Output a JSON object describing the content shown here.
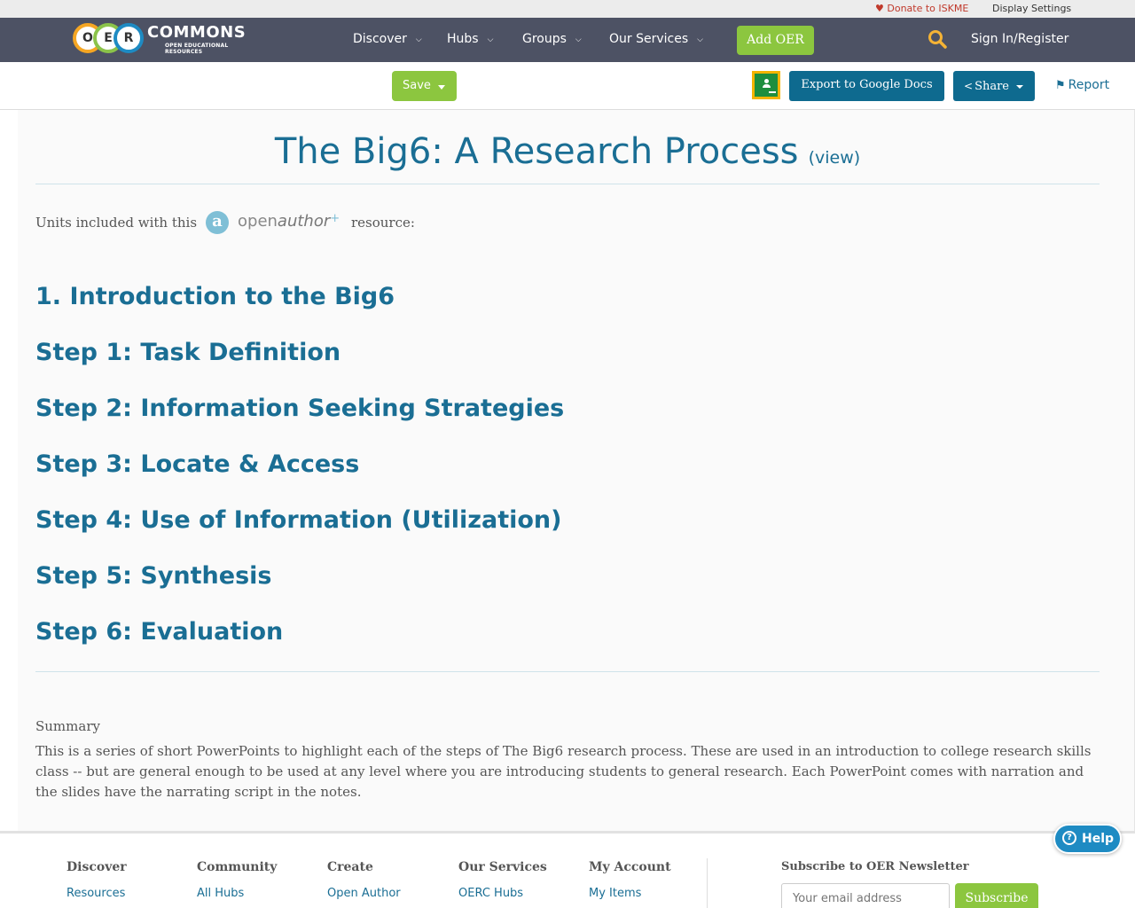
{
  "utility_bar": {
    "donate_label": "Donate to ISKME",
    "display_settings_label": "Display Settings"
  },
  "header": {
    "logo": {
      "letters": [
        "O",
        "E",
        "R"
      ],
      "word": "COMMONS",
      "tagline": "OPEN EDUCATIONAL RESOURCES"
    },
    "nav": [
      {
        "label": "Discover"
      },
      {
        "label": "Hubs"
      },
      {
        "label": "Groups"
      },
      {
        "label": "Our Services"
      }
    ],
    "add_oer_label": "Add OER",
    "sign_in_label": "Sign In/Register"
  },
  "toolbar": {
    "save_label": "Save",
    "export_label": "Export to Google Docs",
    "share_label": "Share",
    "report_label": "Report"
  },
  "resource": {
    "title": "The Big6: A Research Process",
    "view_label": "(view)",
    "units_prefix": "Units included with this",
    "units_suffix": "resource:",
    "units": [
      "1. Introduction to the Big6",
      "Step 1: Task Definition",
      "Step 2: Information Seeking Strategies",
      "Step 3: Locate & Access",
      "Step 4: Use of Information (Utilization)",
      "Step 5: Synthesis",
      "Step 6: Evaluation"
    ],
    "summary_label": "Summary",
    "summary_text": "This is a series of short PowerPoints to highlight each of the steps of The Big6 research process. These are used in an introduction to college research skills class -- but are general enough to be used at any level where you are introducing students to general research. Each PowerPoint comes with narration and the slides have the narrating script in the notes."
  },
  "footer": {
    "columns": [
      {
        "heading": "Discover",
        "link": "Resources"
      },
      {
        "heading": "Community",
        "link": "All Hubs"
      },
      {
        "heading": "Create",
        "link": "Open Author"
      },
      {
        "heading": "Our Services",
        "link": "OERC Hubs"
      },
      {
        "heading": "My Account",
        "link": "My Items"
      }
    ],
    "newsletter_heading": "Subscribe to OER Newsletter",
    "email_placeholder": "Your email address",
    "subscribe_label": "Subscribe"
  },
  "help_label": "Help",
  "colors": {
    "nav_bg": "#4d5264",
    "accent_green": "#8cc63f",
    "link_blue": "#1a6e94",
    "button_blue": "#0e6a8f",
    "donate_red": "#c0392b"
  },
  "icons": [
    "heart-icon",
    "chevron-down-icon",
    "search-icon",
    "google-classroom-icon",
    "share-icon",
    "flag-icon",
    "openauthor-logo",
    "help-icon"
  ]
}
